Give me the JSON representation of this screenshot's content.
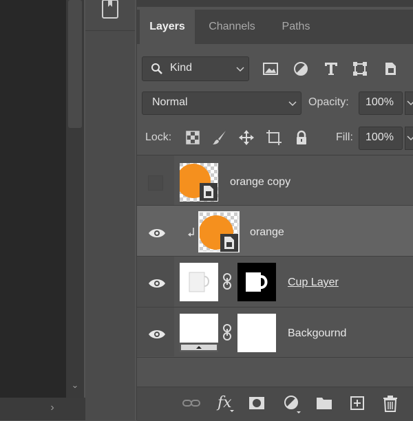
{
  "tabs": [
    {
      "label": "Layers",
      "active": true
    },
    {
      "label": "Channels",
      "active": false
    },
    {
      "label": "Paths",
      "active": false
    }
  ],
  "filter": {
    "kind_label": "Kind",
    "icons": [
      "image-filter-icon",
      "adjustment-filter-icon",
      "type-filter-icon",
      "shape-filter-icon",
      "smart-object-filter-icon"
    ]
  },
  "blend": {
    "mode": "Normal",
    "opacity_label": "Opacity:",
    "opacity_value": "100%"
  },
  "lock": {
    "label": "Lock:",
    "icons": [
      "lock-transparent-pixels-icon",
      "lock-image-pixels-icon",
      "lock-position-icon",
      "lock-artboard-icon",
      "lock-all-icon"
    ],
    "fill_label": "Fill:",
    "fill_value": "100%"
  },
  "layers": [
    {
      "name": "orange copy",
      "visible": false,
      "selected": false,
      "clipped": false,
      "smart_object": true
    },
    {
      "name": "orange",
      "visible": true,
      "selected": true,
      "clipped": true,
      "smart_object": true
    },
    {
      "name": "Cup Layer",
      "visible": true,
      "selected": false,
      "has_mask": true
    },
    {
      "name": "Backgournd",
      "visible": true,
      "selected": false,
      "has_mask": true
    }
  ],
  "bottom_icons": [
    "link-layers-icon",
    "fx-icon",
    "add-mask-icon",
    "adjustment-layer-icon",
    "new-group-icon",
    "new-layer-icon",
    "delete-layer-icon"
  ],
  "colors": {
    "panel_bg": "#535353",
    "selected_row": "#636363",
    "accent_orange": "#f5901e"
  }
}
